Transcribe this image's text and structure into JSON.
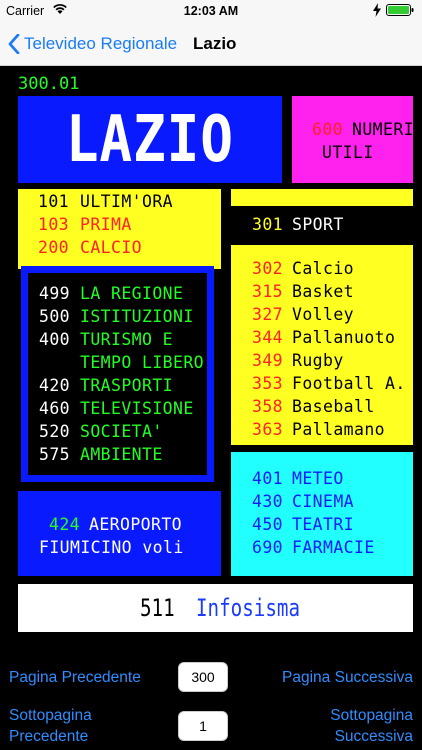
{
  "status_bar": {
    "carrier": "Carrier",
    "time": "12:03 AM"
  },
  "nav": {
    "back_label": "Televideo Regionale",
    "title": "Lazio"
  },
  "teletext": {
    "page_number": "300.01",
    "header_title": "LAZIO",
    "useful": {
      "number": "600",
      "label_1": "NUMERI",
      "label_2": "UTILI"
    },
    "top_left": [
      {
        "num": "101",
        "label": "ULTIM'ORA"
      },
      {
        "num": "103",
        "label": "PRIMA"
      },
      {
        "num": "200",
        "label": "CALCIO"
      }
    ],
    "sport": {
      "num": "301",
      "label": "SPORT"
    },
    "sports": [
      {
        "num": "302",
        "label": "Calcio"
      },
      {
        "num": "315",
        "label": "Basket"
      },
      {
        "num": "327",
        "label": "Volley"
      },
      {
        "num": "344",
        "label": "Pallanuoto"
      },
      {
        "num": "349",
        "label": "Rugby"
      },
      {
        "num": "353",
        "label": "Football A."
      },
      {
        "num": "358",
        "label": "Baseball"
      },
      {
        "num": "363",
        "label": "Pallamano"
      }
    ],
    "region": [
      {
        "num": "499",
        "label": "LA REGIONE"
      },
      {
        "num": "500",
        "label": "ISTITUZIONI"
      },
      {
        "num": "400",
        "label": "TURISMO E"
      },
      {
        "num": "",
        "label": "TEMPO LIBERO"
      },
      {
        "num": "420",
        "label": "TRASPORTI"
      },
      {
        "num": "460",
        "label": "TELEVISIONE"
      },
      {
        "num": "520",
        "label": "SOCIETA'"
      },
      {
        "num": "575",
        "label": "AMBIENTE"
      }
    ],
    "services": [
      {
        "num": "401",
        "label": "METEO"
      },
      {
        "num": "430",
        "label": "CINEMA"
      },
      {
        "num": "450",
        "label": "TEATRI"
      },
      {
        "num": "690",
        "label": "FARMACIE"
      }
    ],
    "airport": {
      "num": "424",
      "label_1": "AEROPORTO",
      "label_2": "FIUMICINO voli"
    },
    "info": {
      "num": "511",
      "label": "Infosisma"
    }
  },
  "controls": {
    "prev_page": "Pagina Precedente",
    "next_page": "Pagina Successiva",
    "page_value": "300",
    "prev_sub_1": "Sottopagina",
    "prev_sub_2": "Precedente",
    "next_sub_1": "Sottopagina",
    "next_sub_2": "Successiva",
    "subpage_value": "1"
  },
  "colors": {
    "teletext_blue": "#0a1aff",
    "teletext_yellow": "#ffff22",
    "teletext_cyan": "#22ffff",
    "teletext_magenta": "#ff22ee",
    "ios_blue": "#2f8dff"
  }
}
